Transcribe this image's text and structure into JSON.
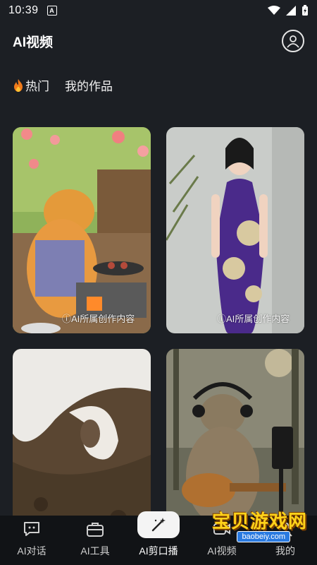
{
  "status_bar": {
    "time": "10:39",
    "notif_label": "A"
  },
  "header": {
    "title": "AI视频"
  },
  "tabs": [
    {
      "label": "热门",
      "icon": "flame-icon"
    },
    {
      "label": "我的作品"
    }
  ],
  "cards": [
    {
      "subject": "cat-cooking",
      "badge": "ⓘAI所属创作内容"
    },
    {
      "subject": "qipao-woman",
      "badge": "ⓘAI所属创作内容"
    },
    {
      "subject": "spiral-tunnel",
      "badge": ""
    },
    {
      "subject": "cat-ukulele",
      "badge": ""
    }
  ],
  "bottom_nav": [
    {
      "label": "AI对话",
      "icon": "chat-icon"
    },
    {
      "label": "AI工具",
      "icon": "toolbox-icon"
    },
    {
      "label": "AI剪口播",
      "icon": "magic-wand-icon",
      "active": true
    },
    {
      "label": "AI视频",
      "icon": "video-icon"
    },
    {
      "label": "我的",
      "icon": "profile-icon"
    }
  ],
  "watermark": {
    "text": "宝贝游戏网",
    "url": "baobeiy.com"
  }
}
